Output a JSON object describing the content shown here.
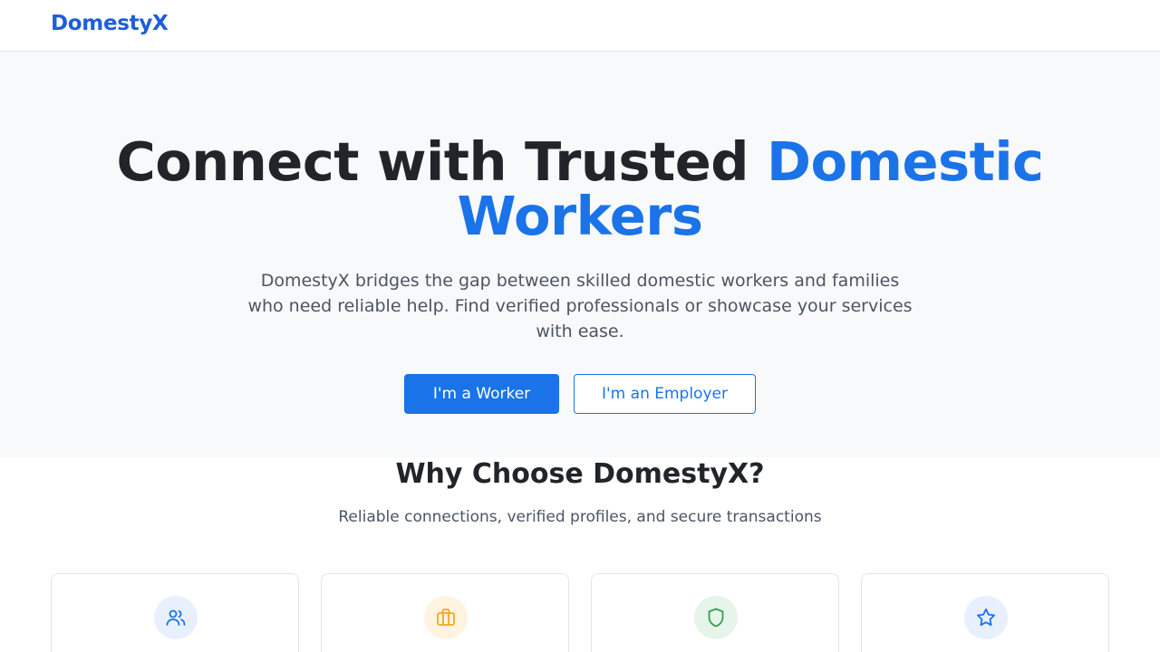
{
  "nav": {
    "brand": "DomestyX"
  },
  "hero": {
    "title_main": "Connect with Trusted ",
    "title_accent_1": "Domestic",
    "title_accent_2": "Workers",
    "description": "DomestyX bridges the gap between skilled domestic workers and families who need reliable help. Find verified professionals or showcase your services with ease.",
    "worker_button": "I'm a Worker",
    "employer_button": "I'm an Employer"
  },
  "features": {
    "title": "Why Choose DomestyX?",
    "subtitle": "Reliable connections, verified profiles, and secure transactions",
    "cards": [
      {
        "icon": "users-icon",
        "color": "#1a73e8",
        "bg": "#e8f0fe"
      },
      {
        "icon": "briefcase-icon",
        "color": "#f5a623",
        "bg": "#fff4e0"
      },
      {
        "icon": "shield-icon",
        "color": "#2e9e4f",
        "bg": "#e6f4ea"
      },
      {
        "icon": "star-icon",
        "color": "#1a73e8",
        "bg": "#e8f0fe"
      }
    ]
  },
  "colors": {
    "brand": "#1f5ed8",
    "accent": "#1a73e8",
    "text": "#212529",
    "muted": "#4b5563",
    "hero_bg": "#f8f9fa"
  }
}
